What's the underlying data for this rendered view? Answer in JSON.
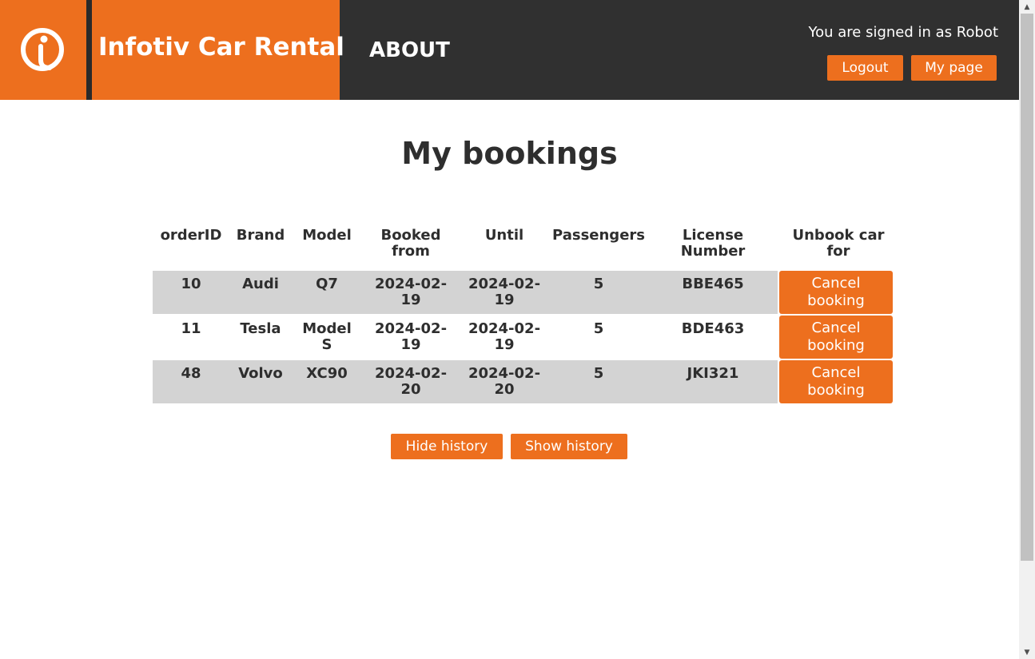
{
  "header": {
    "brand_title": "Infotiv Car Rental",
    "nav_about": "ABOUT",
    "signed_in_text": "You are signed in as Robot",
    "logout_label": "Logout",
    "mypage_label": "My page",
    "logo_icon": "infotiv-i-logo-icon"
  },
  "main": {
    "title": "My bookings",
    "columns": [
      "orderID",
      "Brand",
      "Model",
      "Booked from",
      "Until",
      "Passengers",
      "License Number",
      "Unbook car for"
    ],
    "rows": [
      {
        "orderID": "10",
        "brand": "Audi",
        "model": "Q7",
        "booked_from": "2024-02-19",
        "until": "2024-02-19",
        "passengers": "5",
        "license": "BBE465",
        "action": "Cancel booking"
      },
      {
        "orderID": "11",
        "brand": "Tesla",
        "model": "Model S",
        "booked_from": "2024-02-19",
        "until": "2024-02-19",
        "passengers": "5",
        "license": "BDE463",
        "action": "Cancel booking"
      },
      {
        "orderID": "48",
        "brand": "Volvo",
        "model": "XC90",
        "booked_from": "2024-02-20",
        "until": "2024-02-20",
        "passengers": "5",
        "license": "JKI321",
        "action": "Cancel booking"
      }
    ],
    "hide_history_label": "Hide history",
    "show_history_label": "Show history"
  },
  "colors": {
    "accent": "#ed6f1e",
    "header_bg": "#303030",
    "row_alt_bg": "#d3d3d3"
  }
}
